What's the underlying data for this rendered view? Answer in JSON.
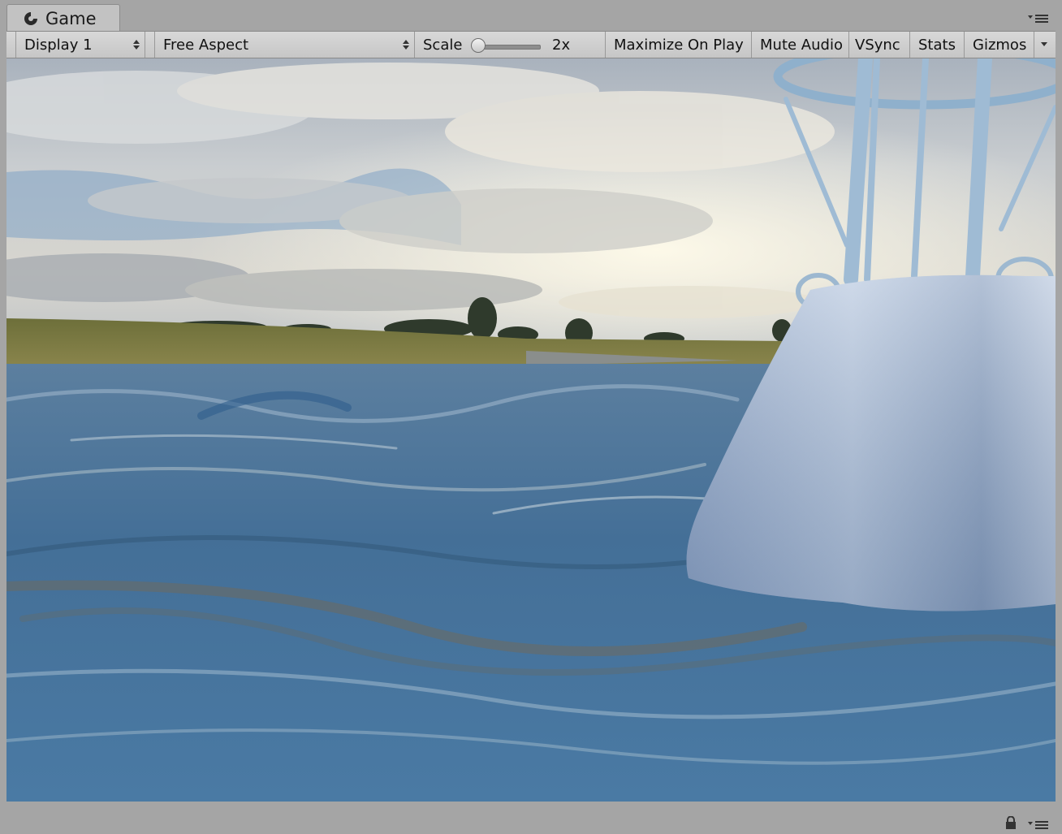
{
  "window": {
    "tab_title": "Game",
    "tab_icon": "unity-game-icon",
    "menu_icon": "context-menu-icon"
  },
  "toolbar": {
    "display_select": "Display 1",
    "aspect_select": "Free Aspect",
    "scale_label": "Scale",
    "scale_value": "2x",
    "scale_slider_fraction": 0.0,
    "maximize_on_play": "Maximize On Play",
    "mute_audio": "Mute Audio",
    "vsync": "VSync",
    "stats": "Stats",
    "gizmos": "Gizmos"
  },
  "viewport": {
    "scene": "ocean-water-with-buoy",
    "colors": {
      "sky_top": "#8fa3b8",
      "cloud": "#e9e6df",
      "grass": "#7b7a3f",
      "water": "#3e6f99",
      "buoy": "#a9bedb"
    }
  },
  "status": {
    "lock_icon": "lock-icon"
  }
}
